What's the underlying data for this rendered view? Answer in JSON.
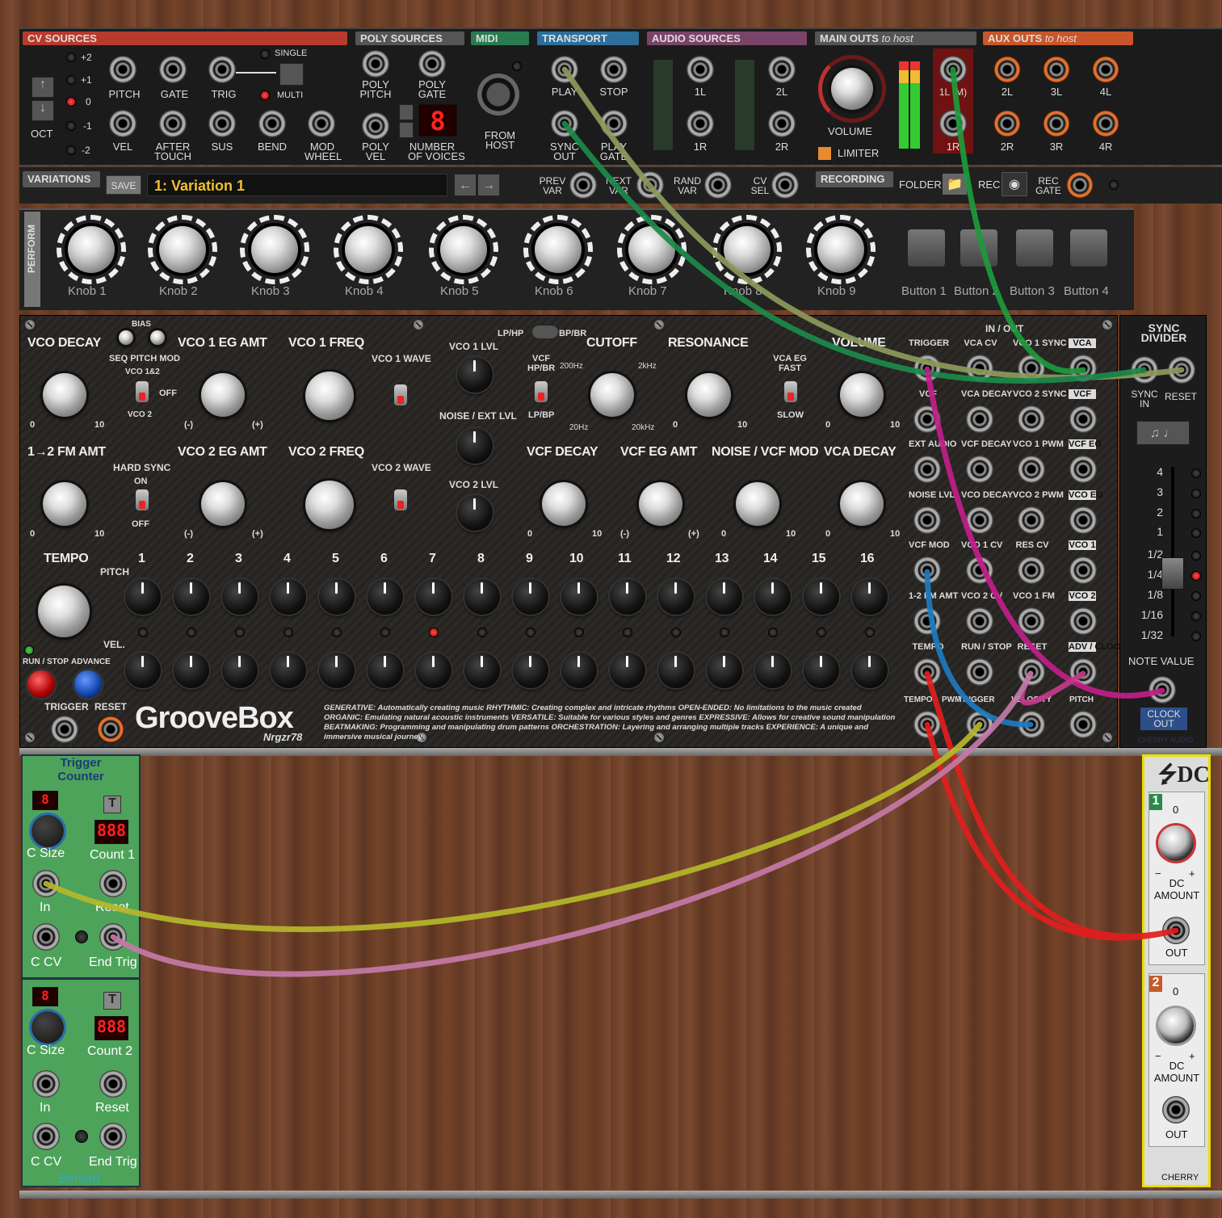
{
  "colors": {
    "cv": "#b83a2c",
    "poly": "#555555",
    "midi": "#2a7b50",
    "transport": "#2d6f9a",
    "audio": "#7a4468",
    "main": "#555555",
    "aux": "#c8562a",
    "perform": "#777777"
  },
  "header": {
    "cv_sources": "CV SOURCES",
    "poly_sources": "POLY SOURCES",
    "midi": "MIDI",
    "transport": "TRANSPORT",
    "audio_sources": "AUDIO SOURCES",
    "main_outs": "MAIN OUTS",
    "main_outs_suffix": "to host",
    "aux_outs": "AUX OUTS",
    "aux_outs_suffix": "to host",
    "oct_labels": [
      "+2",
      "+1",
      "0",
      "-1",
      "-2"
    ],
    "oct": "OCT",
    "single": "SINGLE",
    "multi": "MULTI",
    "cv_jacks_top": [
      "PITCH",
      "GATE",
      "TRIG"
    ],
    "cv_jacks_bottom": [
      "VEL",
      "AFTER\nTOUCH",
      "SUS",
      "BEND",
      "MOD\nWHEEL"
    ],
    "poly_top": [
      "POLY\nPITCH",
      "POLY\nGATE"
    ],
    "poly_bottom": [
      "POLY\nVEL",
      "NUMBER\nOF VOICES"
    ],
    "voices": "8",
    "from_host": "FROM\nHOST",
    "transport_labels": [
      "PLAY",
      "STOP",
      "SYNC\nOUT",
      "PLAY\nGATE"
    ],
    "audio_labels": [
      "1L",
      "2L",
      "1R",
      "2R"
    ],
    "volume": "VOLUME",
    "limiter": "LIMITER",
    "main_jacks": [
      "1L (M)",
      "1R"
    ],
    "aux_labels": [
      "2L",
      "3L",
      "4L",
      "2R",
      "3R",
      "4R"
    ]
  },
  "variations": {
    "title": "VARIATIONS",
    "save": "SAVE",
    "current": "1: Variation 1",
    "prev": "PREV\nVAR",
    "next": "NEXT\nVAR",
    "rand": "RAND\nVAR",
    "cvsel": "CV\nSEL"
  },
  "recording": {
    "title": "RECORDING",
    "folder": "FOLDER",
    "rec": "REC",
    "rec_gate": "REC\nGATE"
  },
  "perform": {
    "title": "PERFORM",
    "knobs": [
      "Knob 1",
      "Knob 2",
      "Knob 3",
      "Knob 4",
      "Knob 5",
      "Knob 6",
      "Knob 7",
      "Knob 8",
      "Knob 9"
    ],
    "buttons": [
      "Button 1",
      "Button 2",
      "Button 3",
      "Button 4"
    ]
  },
  "groovebox": {
    "row1": [
      "VCO DECAY",
      "VCO 1 EG AMT",
      "VCO 1 FREQ",
      "CUTOFF",
      "RESONANCE",
      "VOLUME"
    ],
    "row2": [
      "1→2 FM AMT",
      "VCO 2 EG AMT",
      "VCO 2 FREQ",
      "VCF DECAY",
      "VCF EG AMT",
      "NOISE / VCF MOD",
      "VCA DECAY"
    ],
    "bias": "BIAS",
    "seq_pitch_mod": "SEQ PITCH MOD",
    "vco12": "VCO 1&2",
    "off": "OFF",
    "vco2": "VCO 2",
    "vco1_wave": "VCO 1 WAVE",
    "vco2_wave": "VCO 2 WAVE",
    "vco1_lvl": "VCO 1 LVL",
    "noise_ext": "NOISE / EXT LVL",
    "vco2_lvl": "VCO 2 LVL",
    "lp_hp": "LP/HP",
    "bp_br": "BP/BR",
    "vcf_hpbr": "VCF\nHP/BR",
    "lp_bp": "LP/BP",
    "hz200": "200Hz",
    "khz2": "2kHz",
    "hz20": "20Hz",
    "khz20": "20kHz",
    "vca_eg_fast": "VCA EG\nFAST",
    "slow": "SLOW",
    "hard_sync": "HARD SYNC",
    "on": "ON",
    "tempo": "TEMPO",
    "pitch": "PITCH",
    "vel": "VEL.",
    "run_stop": "RUN / STOP",
    "advance": "ADVANCE",
    "trigger": "TRIGGER",
    "reset": "RESET",
    "steps": [
      "1",
      "2",
      "3",
      "4",
      "5",
      "6",
      "7",
      "8",
      "9",
      "10",
      "11",
      "12",
      "13",
      "14",
      "15",
      "16"
    ],
    "brand": "GrooveBox",
    "author": "Nrgzr78",
    "blurb": "GENERATIVE: Automatically creating music  RHYTHMIC: Creating complex and intricate rhythms  OPEN-ENDED: No limitations to the music created  ORGANIC: Emulating natural acoustic instruments  VERSATILE: Suitable for various styles and genres  EXPRESSIVE: Allows for creative sound manipulation  BEATMAKING: Programming and manipulating drum patterns  ORCHESTRATION: Layering and arranging multiple tracks  EXPERIENCE: A unique and immersive musical journey.",
    "scale": {
      "zero": "0",
      "ten": "10",
      "minus": "(-)",
      "plus": "(+)"
    }
  },
  "io": {
    "in_out": "IN / OUT",
    "rows": [
      [
        "TRIGGER",
        "VCA CV",
        "VCO 1 SYNC",
        "VCA"
      ],
      [
        "VCF",
        "VCA DECAY",
        "VCO 2 SYNC",
        "VCF"
      ],
      [
        "EXT AUDIO",
        "VCF DECAY",
        "VCO 1 PWM",
        "VCF EG"
      ],
      [
        "NOISE LVL",
        "VCO DECAY",
        "VCO 2 PWM",
        "VCO EG"
      ],
      [
        "VCF MOD",
        "VCO 1 CV",
        "RES CV",
        "VCO 1"
      ],
      [
        "1-2 FM AMT",
        "VCO 2 CV",
        "VCO 1 FM",
        "VCO 2"
      ],
      [
        "TEMPO",
        "RUN / STOP",
        "RESET",
        "ADV / CLOCK"
      ],
      [
        "TEMPO",
        "PWM",
        "TRIGGER",
        "VELOCITY",
        "PITCH"
      ]
    ]
  },
  "sync_divider": {
    "title": "SYNC\nDIVIDER",
    "sync_in": "SYNC\nIN",
    "reset": "RESET",
    "scale": [
      "4",
      "3",
      "2",
      "1",
      "1/2",
      "1/4",
      "1/8",
      "1/16",
      "1/32"
    ],
    "note_value": "NOTE VALUE",
    "clock_out": "CLOCK\nOUT",
    "brand": "CHERRY AUDIO"
  },
  "trigger_counter": {
    "title": "Trigger\nCounter",
    "c_size": "C Size",
    "count1": "Count 1",
    "count2": "Count 2",
    "in": "In",
    "reset": "Reset",
    "c_cv": "C CV",
    "end_trig": "End Trig",
    "brand": "Benard",
    "t": "T"
  },
  "dc": {
    "title": "DC",
    "ch1": "1",
    "ch2": "2",
    "zero": "0",
    "minus": "−",
    "plus": "+",
    "amount": "DC\nAMOUNT",
    "out": "OUT",
    "brand": "CHERRY"
  }
}
